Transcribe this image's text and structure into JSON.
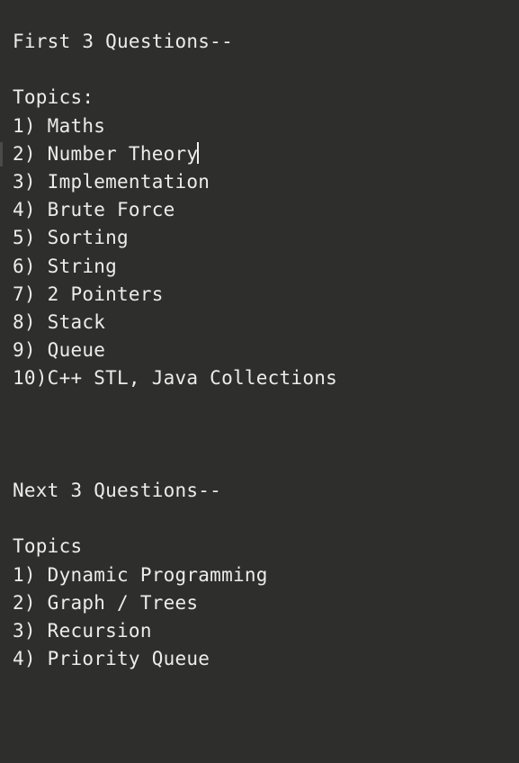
{
  "document": {
    "section1": {
      "heading": "First 3 Questions--",
      "topics_label": "Topics:",
      "items": [
        "1) Maths",
        "2) Number Theory",
        "3) Implementation",
        "4) Brute Force",
        "5) Sorting",
        "6) String",
        "7) 2 Pointers",
        "8) Stack",
        "9) Queue",
        "10)C++ STL, Java Collections"
      ]
    },
    "section2": {
      "heading": "Next 3 Questions--",
      "topics_label": "Topics",
      "items": [
        "1) Dynamic Programming",
        "2) Graph / Trees",
        "3) Recursion",
        "4) Priority Queue"
      ]
    }
  },
  "colors": {
    "background": "#2e2e2c",
    "text": "#ececec"
  }
}
